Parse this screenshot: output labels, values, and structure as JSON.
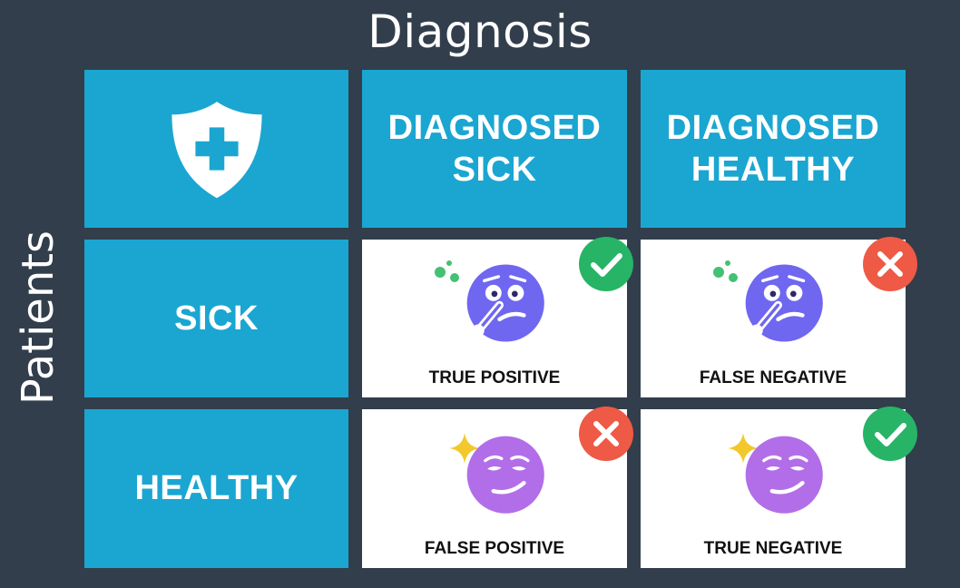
{
  "title": "Diagnosis",
  "side_title": "Patients",
  "columns": [
    "DIAGNOSED\nSICK",
    "DIAGNOSED\nHEALTHY"
  ],
  "column_lines": [
    [
      "DIAGNOSED",
      "SICK"
    ],
    [
      "DIAGNOSED",
      "HEALTHY"
    ]
  ],
  "rows": [
    "SICK",
    "HEALTHY"
  ],
  "cells": {
    "tp": {
      "label": "TRUE POSITIVE",
      "status": "correct"
    },
    "fn": {
      "label": "FALSE NEGATIVE",
      "status": "incorrect"
    },
    "fp": {
      "label": "FALSE POSITIVE",
      "status": "incorrect"
    },
    "tn": {
      "label": "TRUE NEGATIVE",
      "status": "correct"
    }
  },
  "colors": {
    "background": "#323e4c",
    "header_blue": "#1aa6d1",
    "check_green": "#27b467",
    "cross_red": "#ee5a45",
    "sick_face": "#6f67f0",
    "healthy_face": "#b26ee8",
    "sparkle": "#f2c82c",
    "bubbles": "#43c174"
  },
  "icons": {
    "header_corner": "shield-plus-icon",
    "sick_face": "sick-face-thermometer-icon",
    "healthy_face": "smug-face-icon",
    "correct": "check-icon",
    "incorrect": "cross-icon"
  }
}
